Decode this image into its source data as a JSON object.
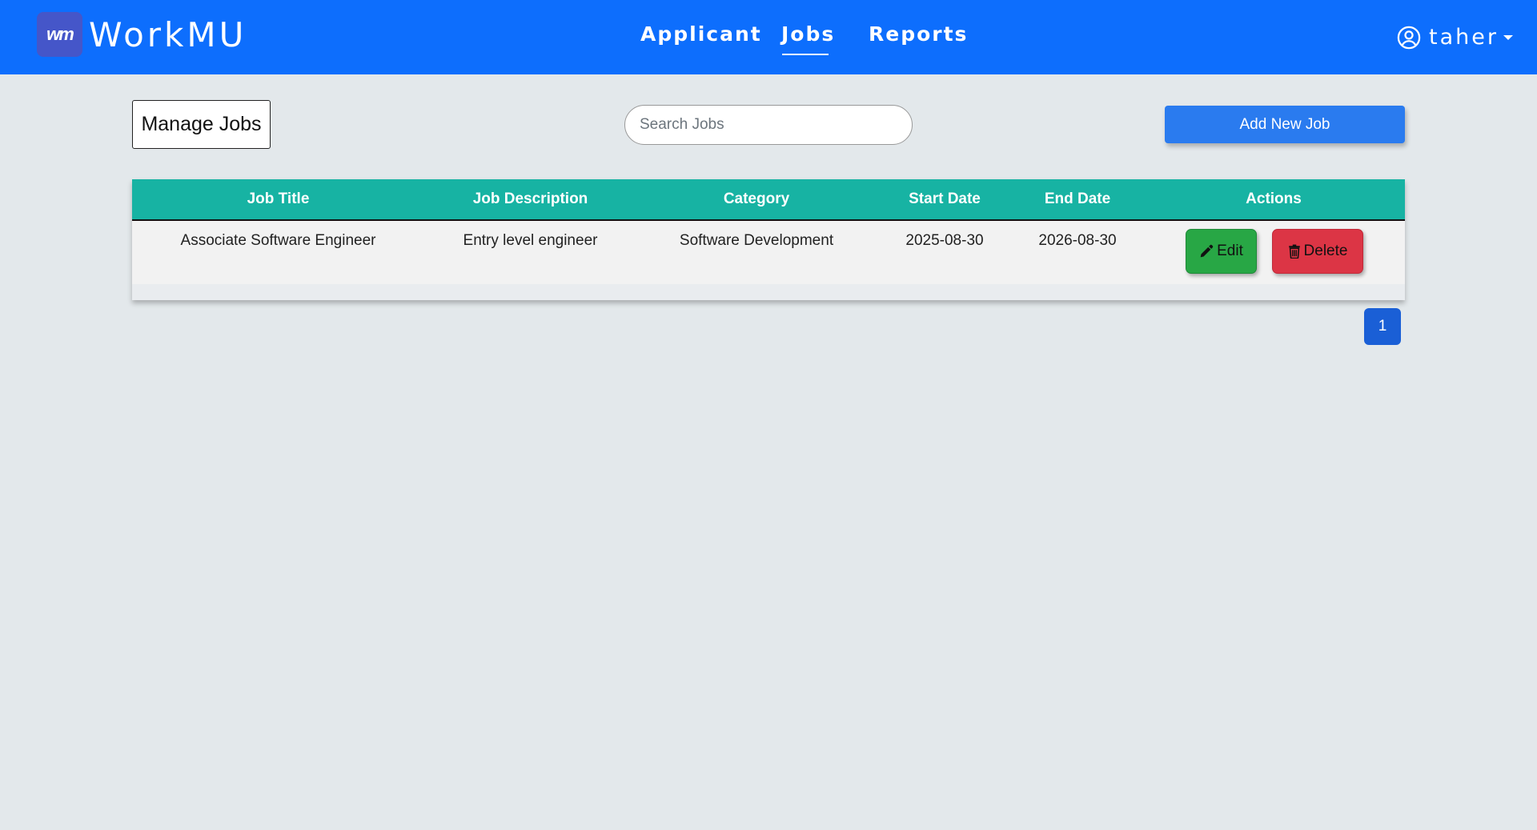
{
  "app": {
    "logo_text": "wm",
    "brand_name": "WorkMU"
  },
  "nav": {
    "items": [
      {
        "label": "Applicant"
      },
      {
        "label": "Jobs"
      },
      {
        "label": "Reports"
      }
    ],
    "active": "Jobs"
  },
  "user": {
    "name": "taher",
    "icon": "user-circle-icon"
  },
  "page": {
    "title": "Manage Jobs"
  },
  "search": {
    "placeholder": "Search Jobs",
    "value": ""
  },
  "toolbar": {
    "add_label": "Add New Job"
  },
  "table": {
    "columns": [
      "Job Title",
      "Job Description",
      "Category",
      "Start Date",
      "End Date",
      "Actions"
    ],
    "rows": [
      {
        "title": "Associate Software Engineer",
        "description": "Entry level engineer",
        "category": "Software Development",
        "start": "2025-08-30",
        "end": "2026-08-30",
        "edit_label": "Edit",
        "delete_label": "Delete"
      }
    ]
  },
  "pagination": {
    "current": "1"
  },
  "colors": {
    "navbar": "#0d6efd",
    "table_header": "#17b3a3",
    "edit": "#28a745",
    "delete": "#dc3545",
    "background": "#e3e8eb"
  }
}
